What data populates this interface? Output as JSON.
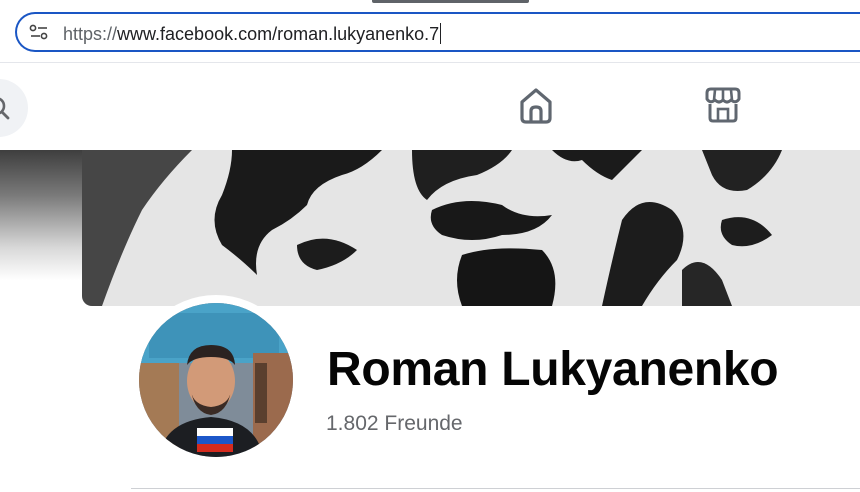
{
  "browser": {
    "url_scheme": "https://",
    "url_rest": "www.facebook.com/roman.lukyanenko.7",
    "site_info_icon": "tune-icon"
  },
  "nav": {
    "search_icon": "search-icon",
    "home_icon": "home-icon",
    "marketplace_icon": "store-icon"
  },
  "profile": {
    "name": "Roman Lukyanenko",
    "friends_text": "1.802 Freunde"
  },
  "colors": {
    "address_border": "#1a56c4",
    "name_text": "#050505",
    "secondary_text": "#65676b"
  }
}
